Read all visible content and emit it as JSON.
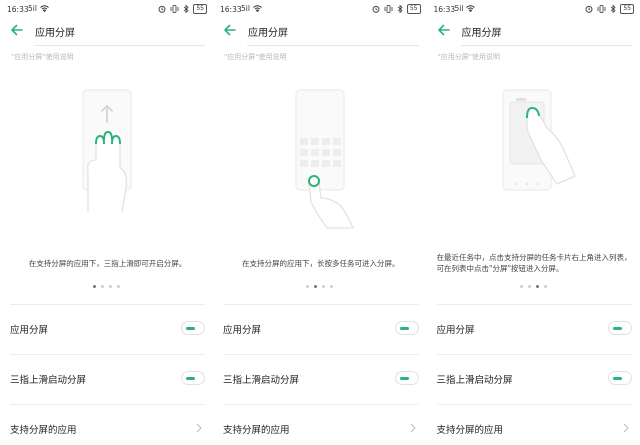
{
  "accent": "#2cb27b",
  "panels": [
    {
      "status": {
        "time": "16:33",
        "signal": "5il",
        "wifi_icon": "wifi-icon",
        "right_icons": [
          "alarm-icon",
          "vibrate-icon",
          "bluetooth-icon"
        ],
        "battery": "55"
      },
      "title": "应用分屏",
      "hint": "\"应用分屏\"使用说明",
      "description": "在支持分屏的应用下，三指上滑即可开启分屏。",
      "page_index": 0,
      "dots": 4,
      "rows": [
        {
          "label": "应用分屏",
          "type": "toggle",
          "on": true
        },
        {
          "label": "三指上滑启动分屏",
          "type": "toggle",
          "on": true
        },
        {
          "label": "支持分屏的应用",
          "type": "link"
        }
      ]
    },
    {
      "status": {
        "time": "16:33",
        "signal": "5il",
        "wifi_icon": "wifi-icon",
        "right_icons": [
          "alarm-icon",
          "vibrate-icon",
          "bluetooth-icon"
        ],
        "battery": "55"
      },
      "title": "应用分屏",
      "hint": "\"应用分屏\"使用说明",
      "description": "在支持分屏的应用下，长按多任务可进入分屏。",
      "page_index": 1,
      "dots": 4,
      "rows": [
        {
          "label": "应用分屏",
          "type": "toggle",
          "on": true
        },
        {
          "label": "三指上滑启动分屏",
          "type": "toggle",
          "on": true
        },
        {
          "label": "支持分屏的应用",
          "type": "link"
        }
      ]
    },
    {
      "status": {
        "time": "16:33",
        "signal": "5il",
        "wifi_icon": "wifi-icon",
        "right_icons": [
          "alarm-icon",
          "vibrate-icon",
          "bluetooth-icon"
        ],
        "battery": "55"
      },
      "title": "应用分屏",
      "hint": "\"应用分屏\"使用说明",
      "description": "在最近任务中，点击支持分屏的任务卡片右上角进入列表，可在列表中点击\"分屏\"按钮进入分屏。",
      "page_index": 2,
      "dots": 4,
      "rows": [
        {
          "label": "应用分屏",
          "type": "toggle",
          "on": true
        },
        {
          "label": "三指上滑启动分屏",
          "type": "toggle",
          "on": true
        },
        {
          "label": "支持分屏的应用",
          "type": "link"
        }
      ]
    }
  ]
}
